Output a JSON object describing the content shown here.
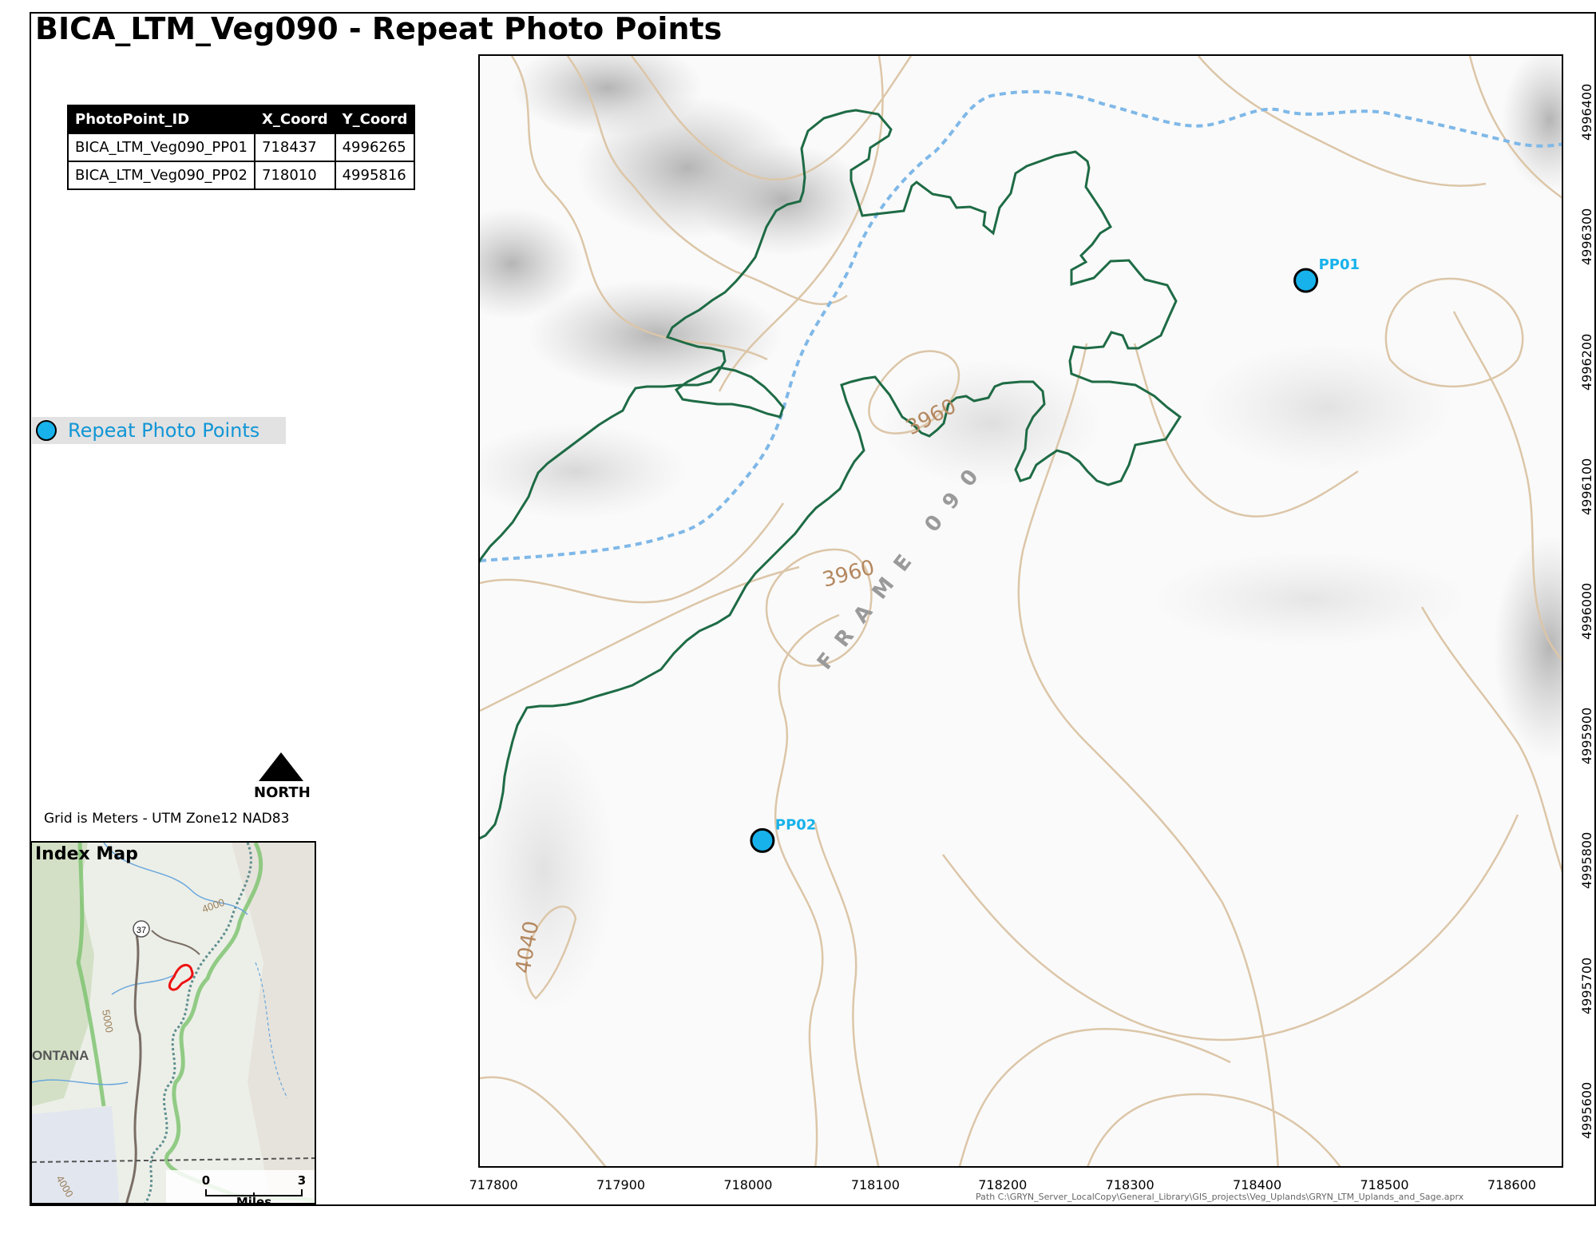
{
  "title": "BICA_LTM_Veg090 - Repeat Photo Points",
  "table": {
    "headers": [
      "PhotoPoint_ID",
      "X_Coord",
      "Y_Coord"
    ],
    "rows": [
      [
        "BICA_LTM_Veg090_PP01",
        "718437",
        "4996265"
      ],
      [
        "BICA_LTM_Veg090_PP02",
        "718010",
        "4995816"
      ]
    ]
  },
  "legend": {
    "label": "Repeat Photo Points",
    "color": "#17b2eb"
  },
  "north_label": "NORTH",
  "grid_note": "Grid is Meters - UTM Zone12 NAD83",
  "index_map": {
    "title": "Index Map",
    "labels": {
      "highway": "37",
      "state": "ONTANA",
      "contour_a": "4000",
      "contour_b": "5000",
      "contour_c": "4000"
    },
    "scale": {
      "start": "0",
      "end": "3",
      "unit": "Miles"
    }
  },
  "main_map": {
    "points": [
      {
        "label": "PP01",
        "x": 718437,
        "y": 4996265
      },
      {
        "label": "PP02",
        "x": 718010,
        "y": 4995816
      }
    ],
    "frame_label": "FRAME 090",
    "contour_labels": [
      "3960",
      "3960",
      "4040"
    ],
    "x_ticks": [
      "717800",
      "717900",
      "718000",
      "718100",
      "718200",
      "718300",
      "718400",
      "718500",
      "718600"
    ],
    "y_ticks": [
      "4995600",
      "4995700",
      "4995800",
      "4995900",
      "4996000",
      "4996100",
      "4996200",
      "4996300",
      "4996400"
    ],
    "colors": {
      "boundary": "#1e6b45",
      "stream": "#7fb8e8",
      "contour": "#dcc6a8",
      "point": "#17b2eb"
    }
  },
  "path_note": "Path C:\\GRYN_Server_LocalCopy\\General_Library\\GIS_projects\\Veg_Uplands\\GRYN_LTM_Uplands_and_Sage.aprx"
}
